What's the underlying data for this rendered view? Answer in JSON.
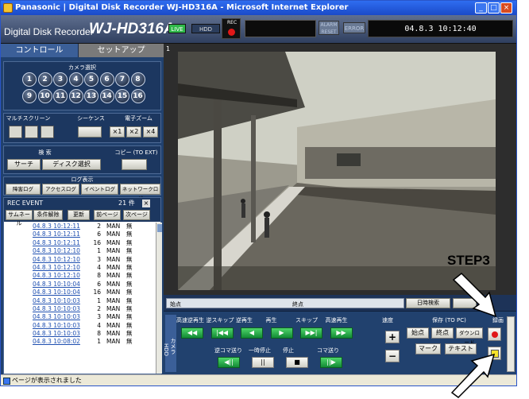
{
  "window": {
    "title": "Panasonic | Digital Disk Recorder WJ-HD316A - Microsoft Internet Explorer",
    "min": "_",
    "max": "□",
    "close": "×"
  },
  "header": {
    "brand_small": "Digital Disk Recorder",
    "brand_big": "WJ-HD316A",
    "live": "LIVE",
    "hdd": "HDD",
    "rec": "REC",
    "alarm_reset": "ALARM RESET",
    "error": "ERROR",
    "datetime": "04.8.3 10:12:40"
  },
  "tabs": {
    "control": "コントロール",
    "setup": "セットアップ"
  },
  "camera_select": {
    "label": "カメラ選択",
    "cameras": [
      "1",
      "2",
      "3",
      "4",
      "5",
      "6",
      "7",
      "8",
      "9",
      "10",
      "11",
      "12",
      "13",
      "14",
      "15",
      "16"
    ]
  },
  "multiscreen": {
    "label": "マルチスクリーン",
    "sequence_label": "シーケンス",
    "zoom_label": "電子ズーム",
    "zoom_options": [
      "×1",
      "×2",
      "×4"
    ]
  },
  "search": {
    "label": "検 索",
    "copy_label": "コピー (TO EXT)",
    "search_btn": "サーチ",
    "disk_btn": "ディスク選択"
  },
  "log": {
    "label": "ログ表示",
    "buttons": [
      "障害ログ",
      "アクセスログ",
      "イベントログ",
      "ネットワークログ"
    ]
  },
  "rec_event": {
    "title": "REC EVENT",
    "count": "21 件",
    "close": "×",
    "buttons": [
      "サムネール",
      "条件解除",
      "更新",
      "前ページ",
      "次ページ"
    ],
    "rows": [
      [
        "04.8.3 10:12:11",
        "2",
        "MAN",
        "無"
      ],
      [
        "04.8.3 10:12:11",
        "6",
        "MAN",
        "無"
      ],
      [
        "04.8.3 10:12:11",
        "16",
        "MAN",
        "無"
      ],
      [
        "04.8.3 10:12:10",
        "1",
        "MAN",
        "無"
      ],
      [
        "04.8.3 10:12:10",
        "3",
        "MAN",
        "無"
      ],
      [
        "04.8.3 10:12:10",
        "4",
        "MAN",
        "無"
      ],
      [
        "04.8.3 10:12:10",
        "8",
        "MAN",
        "無"
      ],
      [
        "04.8.3 10:10:04",
        "6",
        "MAN",
        "無"
      ],
      [
        "04.8.3 10:10:04",
        "16",
        "MAN",
        "無"
      ],
      [
        "04.8.3 10:10:03",
        "1",
        "MAN",
        "無"
      ],
      [
        "04.8.3 10:10:03",
        "2",
        "MAN",
        "無"
      ],
      [
        "04.8.3 10:10:03",
        "3",
        "MAN",
        "無"
      ],
      [
        "04.8.3 10:10:03",
        "4",
        "MAN",
        "無"
      ],
      [
        "04.8.3 10:10:03",
        "8",
        "MAN",
        "無"
      ],
      [
        "04.8.3 10:08:02",
        "1",
        "MAN",
        "無"
      ]
    ]
  },
  "video": {
    "camera_number": "1"
  },
  "timeline": {
    "start": "始点",
    "end": "終点",
    "date_search": "日時検索"
  },
  "control_panel": {
    "camera_tag": "カメラ",
    "hdd_tag": "HDD",
    "row1_labels": [
      "高速逆再生",
      "逆スキップ",
      "逆再生",
      "再生",
      "スキップ",
      "高速再生"
    ],
    "row1_glyphs": [
      "◀◀",
      "|◀◀",
      "◀",
      "▶",
      "▶▶|",
      "▶▶"
    ],
    "row2_labels": [
      "逆コマ送り",
      "一時停止",
      "停止",
      "コマ送り"
    ],
    "row2_glyphs": [
      "◀||",
      "||",
      "■",
      "||▶"
    ],
    "speed_label": "速度",
    "plus": "+",
    "minus": "−",
    "save_label": "保存 (TO PC)",
    "save_buttons": [
      "始点",
      "終点",
      "ダウンロード"
    ],
    "mark": "マーク",
    "text": "テキスト",
    "record_label": "録画"
  },
  "status": {
    "text": "ページが表示されました"
  },
  "overlay": {
    "step": "STEP3"
  },
  "colors": {
    "panel": "#21416e",
    "play_green": "#128a35",
    "rec_red": "#e01818",
    "stop_yellow": "#f7e22a"
  }
}
